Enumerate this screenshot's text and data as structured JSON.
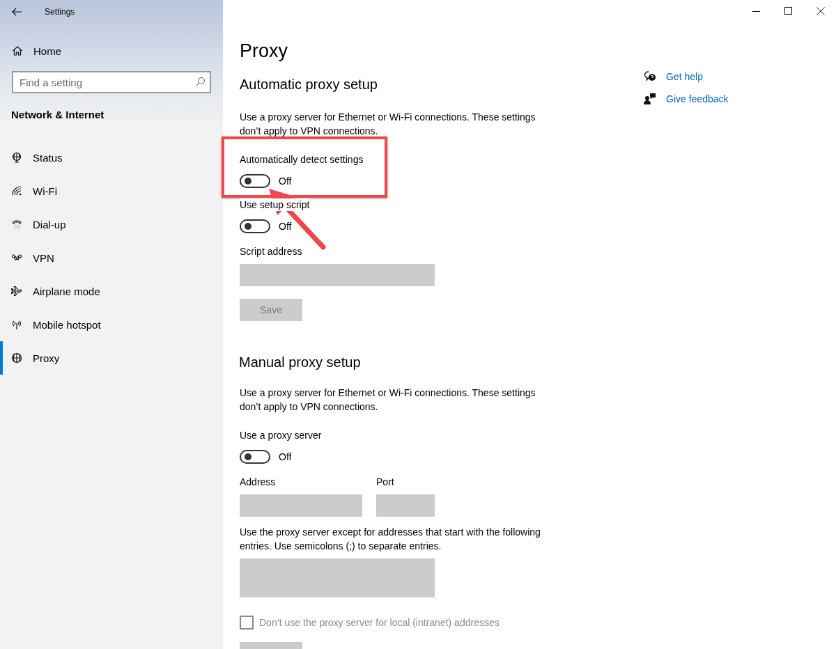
{
  "window": {
    "title": "Settings"
  },
  "sidebar": {
    "home": "Home",
    "search": {
      "placeholder": "Find a setting"
    },
    "section_title": "Network & Internet",
    "items": [
      {
        "label": "Status",
        "selected": false
      },
      {
        "label": "Wi-Fi",
        "selected": false
      },
      {
        "label": "Dial-up",
        "selected": false
      },
      {
        "label": "VPN",
        "selected": false
      },
      {
        "label": "Airplane mode",
        "selected": false
      },
      {
        "label": "Mobile hotspot",
        "selected": false
      },
      {
        "label": "Proxy",
        "selected": true
      }
    ]
  },
  "page": {
    "title": "Proxy",
    "sections": [
      {
        "heading": "Automatic proxy setup",
        "description": "Use a proxy server for Ethernet or Wi-Fi connections. These settings don’t apply to VPN connections.",
        "settings": [
          {
            "kind": "toggle",
            "label": "Automatically detect settings",
            "on": false,
            "state_text": "Off",
            "highlighted": true
          },
          {
            "kind": "toggle",
            "label": "Use setup script",
            "on": false,
            "state_text": "Off",
            "highlighted": false
          },
          {
            "kind": "field",
            "label": "Script address",
            "disabled": true
          },
          {
            "kind": "button",
            "label": "Save",
            "disabled": true
          }
        ]
      },
      {
        "heading": "Manual proxy setup",
        "description": "Use a proxy server for Ethernet or Wi-Fi connections. These settings don’t apply to VPN connections.",
        "settings": [
          {
            "kind": "toggle",
            "label": "Use a proxy server",
            "on": false,
            "state_text": "Off",
            "highlighted": false
          },
          {
            "kind": "fields",
            "fields": [
              {
                "label": "Address",
                "disabled": true
              },
              {
                "label": "Port",
                "disabled": true
              }
            ]
          },
          {
            "kind": "textarea",
            "label": "Use the proxy server except for addresses that start with the following entries. Use semicolons (;) to separate entries.",
            "disabled": true
          },
          {
            "kind": "checkbox",
            "label": "Don’t use the proxy server for local (intranet) addresses",
            "checked": false,
            "disabled": true
          },
          {
            "kind": "button",
            "disabled": true
          }
        ]
      }
    ]
  },
  "help_links": [
    {
      "label": "Get help"
    },
    {
      "label": "Give feedback"
    }
  ]
}
